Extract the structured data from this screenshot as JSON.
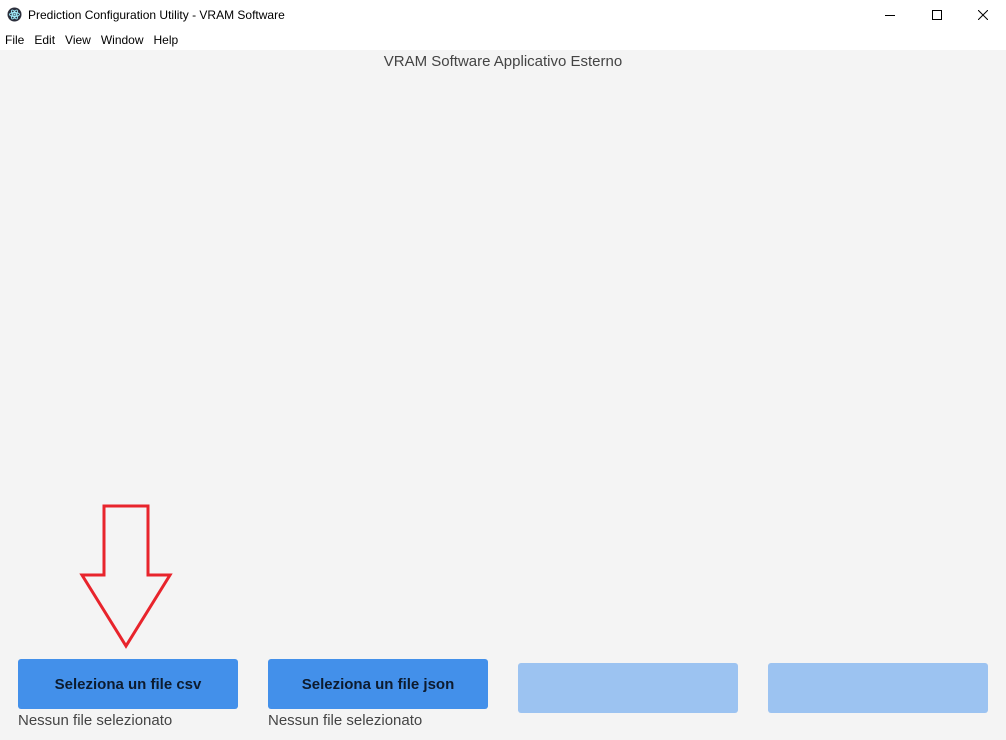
{
  "window": {
    "title": "Prediction Configuration Utility - VRAM Software",
    "icon": "electron-app-icon",
    "controls": [
      "minimize-icon",
      "maximize-icon",
      "close-icon"
    ]
  },
  "menubar": {
    "items": [
      {
        "label": "File"
      },
      {
        "label": "Edit"
      },
      {
        "label": "View"
      },
      {
        "label": "Window"
      },
      {
        "label": "Help"
      }
    ]
  },
  "main": {
    "heading": "VRAM Software Applicativo Esterno",
    "annotation": {
      "type": "arrow-down-icon",
      "color": "#e8242c"
    },
    "buttons": [
      {
        "label": "Seleziona un file csv",
        "status": "Nessun file selezionato",
        "color": "#4390ea"
      },
      {
        "label": "Seleziona un file json",
        "status": "Nessun file selezionato",
        "color": "#4390ea"
      },
      {
        "label": "",
        "color": "#9cc3f1"
      },
      {
        "label": "",
        "color": "#9cc3f1"
      }
    ]
  },
  "colors": {
    "content_background": "#f4f4f4",
    "button_primary": "#4390ea",
    "button_disabled": "#9cc3f1",
    "annotation_red": "#e8242c"
  }
}
